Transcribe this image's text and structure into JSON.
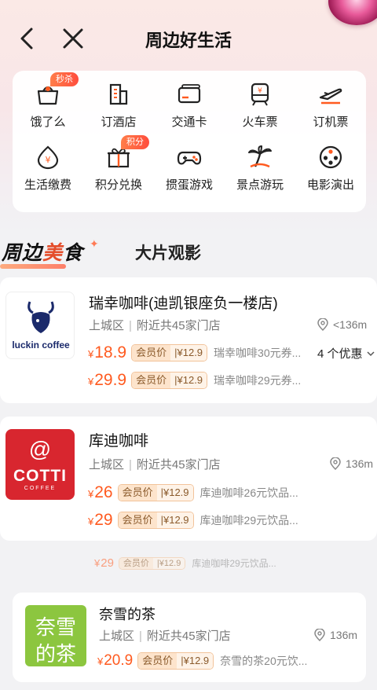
{
  "nav": {
    "title": "周边好生活"
  },
  "grid": [
    {
      "label": "饿了么",
      "icon": "basket-icon",
      "badge": "秒杀"
    },
    {
      "label": "订酒店",
      "icon": "hotel-icon"
    },
    {
      "label": "交通卡",
      "icon": "card-icon"
    },
    {
      "label": "火车票",
      "icon": "train-icon"
    },
    {
      "label": "订机票",
      "icon": "plane-icon"
    },
    {
      "label": "生活缴费",
      "icon": "payment-icon"
    },
    {
      "label": "积分兑换",
      "icon": "gift-icon",
      "badge": "积分"
    },
    {
      "label": "掼蛋游戏",
      "icon": "gamepad-icon"
    },
    {
      "label": "景点游玩",
      "icon": "palm-tree-icon"
    },
    {
      "label": "电影演出",
      "icon": "film-reel-icon"
    }
  ],
  "tabs": {
    "active_a": "周边",
    "active_b": "美",
    "active_c": "食",
    "inactive": "大片观影"
  },
  "stores": [
    {
      "name": "瑞幸咖啡(迪凯银座负一楼店)",
      "district": "上城区",
      "nearby": "附近共45家门店",
      "distance": "<136m",
      "logo_text": "luckin coffee",
      "offers": "4 个优惠",
      "deals": [
        {
          "yen": "¥",
          "price": "18.9",
          "member_label": "会员价",
          "member_price": "|¥12.9",
          "desc": "瑞幸咖啡30元券..."
        },
        {
          "yen": "¥",
          "price": "29.9",
          "member_label": "会员价",
          "member_price": "|¥12.9",
          "desc": "瑞幸咖啡29元券..."
        }
      ]
    },
    {
      "name": "库迪咖啡",
      "district": "上城区",
      "nearby": "附近共45家门店",
      "distance": "136m",
      "logo_text": "COTTI",
      "logo_sub": "COFFEE",
      "deals": [
        {
          "yen": "¥",
          "price": "26",
          "member_label": "会员价",
          "member_price": "|¥12.9",
          "desc": "库迪咖啡26元饮品..."
        },
        {
          "yen": "¥",
          "price": "29",
          "member_label": "会员价",
          "member_price": "|¥12.9",
          "desc": "库迪咖啡29元饮品..."
        }
      ]
    },
    {
      "name": "奈雪的茶",
      "district": "上城区",
      "nearby": "附近共45家门店",
      "distance": "136m",
      "logo_text_1": "奈雪",
      "logo_text_2": "的茶",
      "deals": [
        {
          "yen": "¥",
          "price": "20.9",
          "member_label": "会员价",
          "member_price": "|¥12.9",
          "desc": "奈雪的茶20元饮..."
        }
      ]
    }
  ],
  "colors": {
    "accent": "#ff5a1f",
    "cotti_red": "#d8262f",
    "naixue_green": "#8cc63f",
    "luckin_blue": "#1b2a6b"
  }
}
